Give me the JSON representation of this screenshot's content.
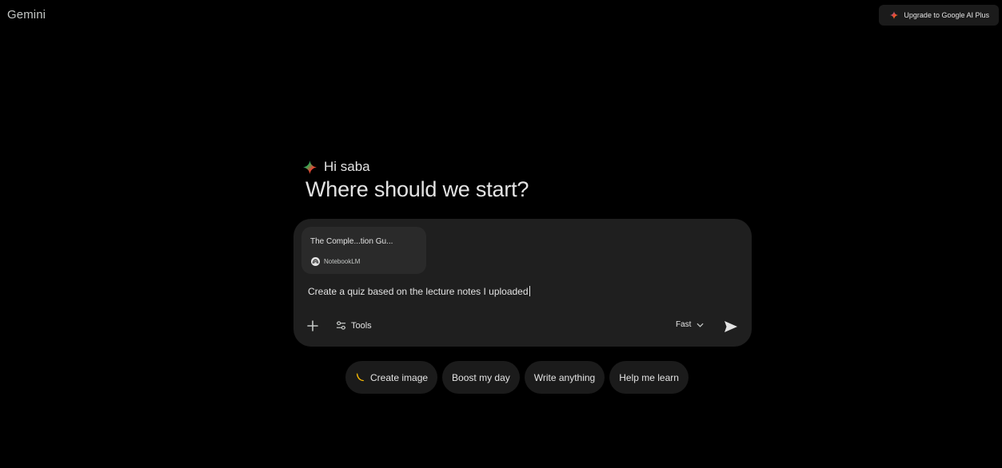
{
  "header": {
    "brand": "Gemini",
    "upgrade_label": "Upgrade to Google AI Plus"
  },
  "greeting": {
    "hello": "Hi saba",
    "headline": "Where should we start?"
  },
  "composer": {
    "attachment": {
      "title": "The Comple...tion Gu...",
      "source": "NotebookLM"
    },
    "input_value": "Create a quiz based on the lecture notes I uploaded",
    "tools_label": "Tools",
    "mode_label": "Fast"
  },
  "chips": [
    {
      "label": "Create image",
      "icon": "banana-icon"
    },
    {
      "label": "Boost my day"
    },
    {
      "label": "Write anything"
    },
    {
      "label": "Help me learn"
    }
  ],
  "colors": {
    "background": "#000000",
    "composer": "#1f1f1f",
    "chip": "#1b1b1b",
    "text": "#e3e3e3",
    "accent_blue": "#4a8df8",
    "accent_red": "#ea4335",
    "accent_yellow": "#fbbc04",
    "accent_green": "#34a853"
  }
}
